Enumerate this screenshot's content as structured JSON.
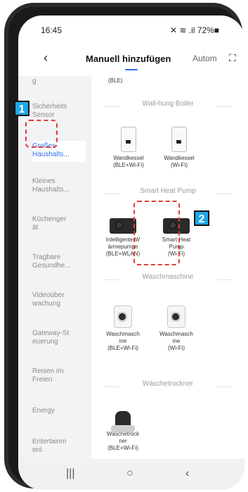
{
  "status": {
    "time": "16:45",
    "icons": "✕ ≋ .il 72%■"
  },
  "header": {
    "back": "‹",
    "title": "Manuell hinzufügen",
    "auto": "Autom",
    "scan": "⛶"
  },
  "sidebar": {
    "items": [
      {
        "label": "g"
      },
      {
        "label": "Sicherheits\nSensor"
      },
      {
        "label": "Großes\nHaushalts..."
      },
      {
        "label": "Kleines\nHaushalts..."
      },
      {
        "label": "Küchenger\nät"
      },
      {
        "label": "Tragbare\nGesundhe..."
      },
      {
        "label": "Videoüber\nwachung"
      },
      {
        "label": "Gateway-St\neuerung"
      },
      {
        "label": "Reisen im\nFreien"
      },
      {
        "label": "Energy"
      },
      {
        "label": "Entertainm\nent"
      }
    ]
  },
  "content": {
    "top_label": "(BLE)",
    "sections": [
      {
        "title": "Wall-hung Boiler"
      },
      {
        "title": "Smart Heat Pump"
      },
      {
        "title": "Waschmaschine"
      },
      {
        "title": "Wäschetrockner"
      }
    ],
    "items": [
      {
        "label": "Wandkessel\n(BLE+Wi-Fi)",
        "icon": "boiler-icon"
      },
      {
        "label": "Wandkessel\n(Wi-Fi)",
        "icon": "boiler-icon"
      },
      {
        "label": "Intelligente W\närmepumpe\n(BLE+WLAN)",
        "icon": "heat-pump-icon"
      },
      {
        "label": "Smart Heat\nPump\n(Wi-Fi)",
        "icon": "heat-pump-icon"
      },
      {
        "label": "Waschmasch\nine\n(BLE+Wi-Fi)",
        "icon": "washer-icon"
      },
      {
        "label": "Waschmasch\nine\n(Wi-Fi)",
        "icon": "washer-icon"
      },
      {
        "label": "Wäschetrock\nner\n(BLE+Wi-Fi)",
        "icon": "dryer-icon"
      }
    ]
  },
  "bottom": {
    "recent": "|||",
    "home": "○",
    "back": "‹"
  },
  "badges": {
    "one": "1",
    "two": "2"
  },
  "colors": {
    "accent": "#2f6ff0",
    "highlight": "#e53935",
    "badge": "#1da7e6"
  }
}
